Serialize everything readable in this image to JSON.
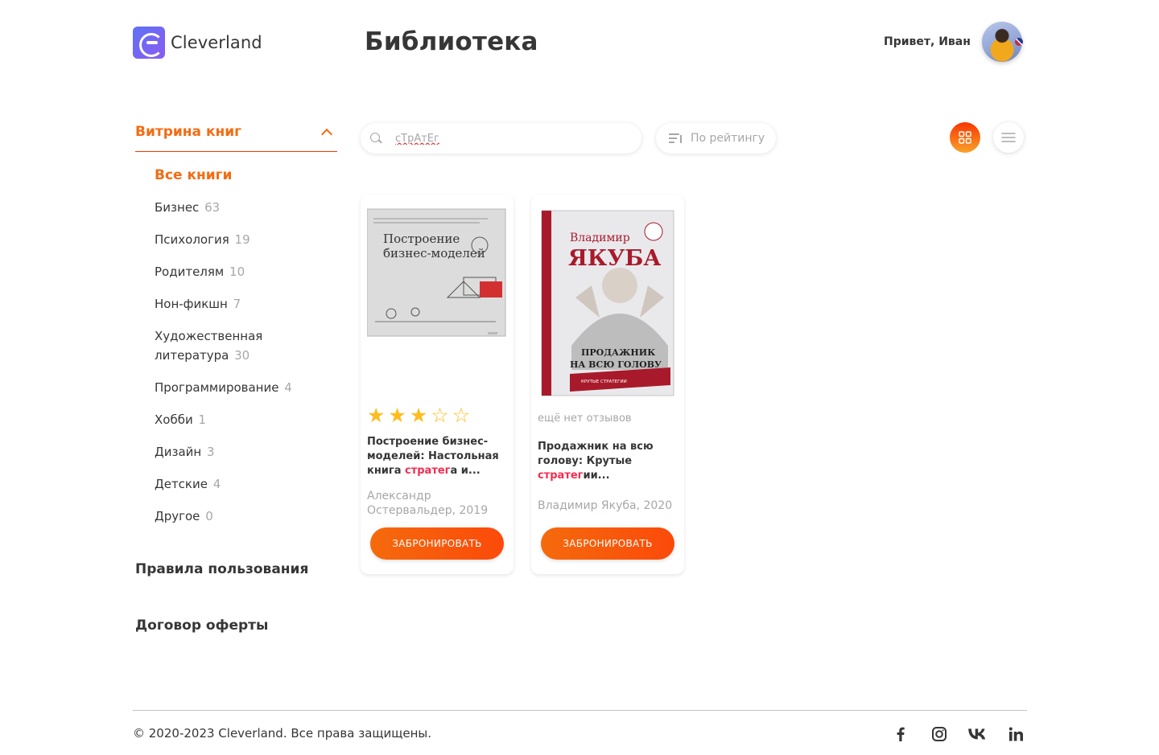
{
  "header": {
    "logo_text": "Cleverland",
    "page_title": "Библиотека",
    "greeting": "Привет, Иван"
  },
  "sidebar": {
    "showcase_title": "Витрина книг",
    "categories": [
      {
        "label": "Все книги",
        "count": ""
      },
      {
        "label": "Бизнес",
        "count": "63"
      },
      {
        "label": "Психология",
        "count": "19"
      },
      {
        "label": "Родителям",
        "count": "10"
      },
      {
        "label": "Нон-фикшн",
        "count": "7"
      },
      {
        "label": "Художественная литература",
        "count": "30"
      },
      {
        "label": "Программирование",
        "count": "4"
      },
      {
        "label": "Хобби",
        "count": "1"
      },
      {
        "label": "Дизайн",
        "count": "3"
      },
      {
        "label": "Детские",
        "count": "4"
      },
      {
        "label": "Другое",
        "count": "0"
      }
    ],
    "terms_link": "Правила пользования",
    "offer_link": "Договор оферты"
  },
  "toolbar": {
    "search_value": "сТрАтЕг",
    "sort_label": "По рейтингу"
  },
  "books": [
    {
      "rating": 3,
      "rating_max": 5,
      "title_before": "Построение бизнес-моделей: Настольная книга ",
      "title_highlight": "стратег",
      "title_after": "а и...",
      "author": "Александр Остервальдер, 2019",
      "button": "ЗАБРОНИРОВАТЬ",
      "cover": {
        "line1": "Построение",
        "line2": "бизнес-моделей"
      }
    },
    {
      "rating": null,
      "no_reviews": "ещё нет отзывов",
      "title_before": "Продажник на всю голову: Крутые ",
      "title_highlight": "стратег",
      "title_after": "ии...",
      "author": "Владимир Якуба, 2020",
      "button": "ЗАБРОНИРОВАТЬ",
      "cover": {
        "author1": "Владимир",
        "author2": "ЯКУБА",
        "title1": "ПРОДАЖНИК",
        "title2": "НА ВСЮ ГОЛОВУ",
        "sub": "КРУТЫЕ СТРАТЕГИИ ПРОФЕССИОНАЛА"
      }
    }
  ],
  "footer": {
    "copyright": "© 2020-2023 Cleverland. Все права защищены."
  },
  "colors": {
    "accent": "#f36c13",
    "highlight": "#f42c4f",
    "star": "#ffbc1f",
    "text": "#363636",
    "muted": "#a7a7a7"
  }
}
